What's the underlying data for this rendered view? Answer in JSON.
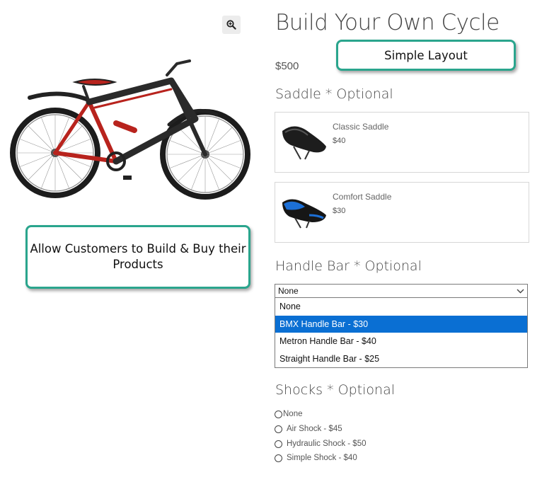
{
  "product": {
    "title": "Build Your Own Cycle",
    "price": "$500"
  },
  "icons": {
    "zoom": "zoom-in-icon",
    "chevron": "chevron-down-icon"
  },
  "callouts": {
    "left": "Allow Customers to Build & Buy their Products",
    "top": "Simple Layout"
  },
  "saddle": {
    "heading": "Saddle * Optional",
    "options": [
      {
        "name": "Classic Saddle",
        "price": "$40"
      },
      {
        "name": "Comfort Saddle",
        "price": "$30"
      }
    ]
  },
  "handlebar": {
    "heading": "Handle Bar * Optional",
    "selected": "None",
    "options": [
      "None",
      "BMX Handle Bar - $30",
      "Metron Handle Bar - $40",
      "Straight Handle Bar - $25"
    ],
    "highlighted_index": 1
  },
  "shocks": {
    "heading": "Shocks * Optional",
    "options": [
      "None",
      "Air Shock - $45",
      "Hydraulic Shock - $50",
      "Simple Shock - $40"
    ]
  },
  "colors": {
    "accent_border": "#2aa58d",
    "highlight": "#0a6fd3"
  }
}
